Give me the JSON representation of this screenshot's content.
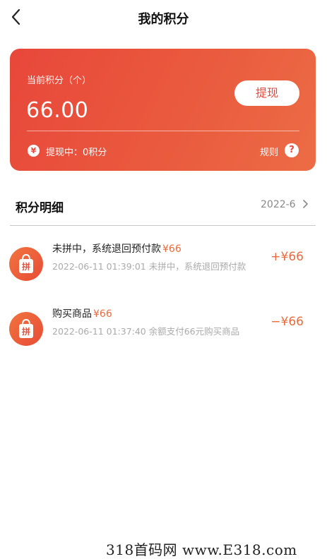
{
  "header": {
    "title": "我的积分"
  },
  "card": {
    "label": "当前积分（个）",
    "value": "66.00",
    "withdraw_label": "提现",
    "pending_text": "提现中：0积分",
    "rules_label": "规则",
    "yuan_symbol": "¥",
    "help_symbol": "?"
  },
  "section": {
    "title": "积分明细",
    "month": "2022-6"
  },
  "records": [
    {
      "icon_char": "拼",
      "title": "未拼中，系统退回预付款",
      "amount": "¥66",
      "subtitle": "2022-06-11 01:39:01 未拼中，系统退回预付款",
      "change": "+¥66"
    },
    {
      "icon_char": "拼",
      "title": "购买商品",
      "amount": "¥66",
      "subtitle": "2022-06-11 01:37:40 余额支付66元购买商品",
      "change": "−¥66"
    }
  ],
  "watermark": "318首码网 www.E318.com",
  "colors": {
    "accent": "#e8473a",
    "accent_light": "#ec6a3c",
    "muted": "#aaaaaa"
  }
}
